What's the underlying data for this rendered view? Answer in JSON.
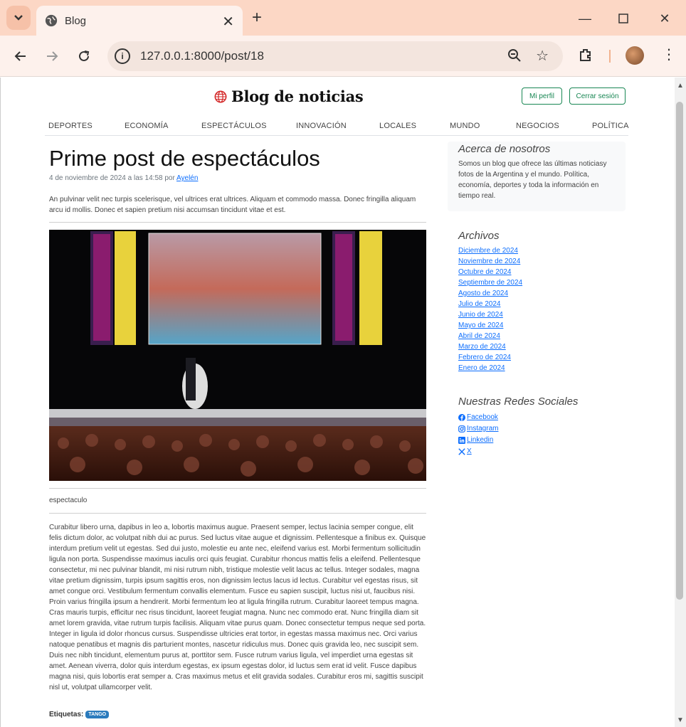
{
  "browser": {
    "tab_title": "Blog",
    "url": "127.0.0.1:8000/post/18"
  },
  "header": {
    "brand": "Blog de noticias",
    "profile_button": "Mi perfil",
    "logout_button": "Cerrar sesión"
  },
  "nav": {
    "items": [
      {
        "label": "DEPORTES"
      },
      {
        "label": "ECONOMÍA"
      },
      {
        "label": "ESPECTÁCULOS"
      },
      {
        "label": "INNOVACIÓN"
      },
      {
        "label": "LOCALES"
      },
      {
        "label": "MUNDO"
      },
      {
        "label": "NEGOCIOS"
      },
      {
        "label": "POLÍTICA"
      }
    ]
  },
  "post": {
    "title": "Prime post de espectáculos",
    "meta": "4 de noviembre de 2024 a las 14:58 por ",
    "author": "Ayelén",
    "lead": "An pulvinar velit nec turpis scelerisque, vel ultrices erat ultrices. Aliquam et commodo massa. Donec fringilla aliquam arcu id mollis. Donec et sapien pretium nisi accumsan tincidunt vitae et est.",
    "caption": "espectaculo",
    "body": "Curabitur libero urna, dapibus in leo a, lobortis maximus augue. Praesent semper, lectus lacinia semper congue, elit felis dictum dolor, ac volutpat nibh dui ac purus. Sed luctus vitae augue et dignissim. Pellentesque a finibus ex. Quisque interdum pretium velit ut egestas. Sed dui justo, molestie eu ante nec, eleifend varius est. Morbi fermentum sollicitudin ligula non porta. Suspendisse maximus iaculis orci quis feugiat. Curabitur rhoncus mattis felis a eleifend. Pellentesque consectetur, mi nec pulvinar blandit, mi nisi rutrum nibh, tristique molestie velit lacus ac tellus. Integer sodales, magna vitae pretium dignissim, turpis ipsum sagittis eros, non dignissim lectus lacus id lectus. Curabitur vel egestas risus, sit amet congue orci. Vestibulum fermentum convallis elementum. Fusce eu sapien suscipit, luctus nisi ut, faucibus nisi. Proin varius fringilla ipsum a hendrerit. Morbi fermentum leo at ligula fringilla rutrum. Curabitur laoreet tempus magna. Cras mauris turpis, efficitur nec risus tincidunt, laoreet feugiat magna. Nunc nec commodo erat. Nunc fringilla diam sit amet lorem gravida, vitae rutrum turpis facilisis. Aliquam vitae purus quam. Donec consectetur tempus neque sed porta. Integer in ligula id dolor rhoncus cursus. Suspendisse ultricies erat tortor, in egestas massa maximus nec. Orci varius natoque penatibus et magnis dis parturient montes, nascetur ridiculus mus. Donec quis gravida leo, nec suscipit sem. Duis nec nibh tincidunt, elementum purus at, porttitor sem. Fusce rutrum varius ligula, vel imperdiet urna egestas sit amet. Aenean viverra, dolor quis interdum egestas, ex ipsum egestas dolor, id luctus sem erat id velit. Fusce dapibus magna nisi, quis lobortis erat semper a. Cras maximus metus et elit gravida sodales. Curabitur eros mi, sagittis suscipit nisl ut, volutpat ullamcorper velit.",
    "tags_label": "Etiquetas:",
    "tag": "TANGO"
  },
  "sidebar": {
    "about_title": "Acerca de nosotros",
    "about_text": "Somos un blog que ofrece las últimas noticiasy fotos de la Argentina y el mundo. Política, economía, deportes y toda la información en tiempo real.",
    "archives_title": "Archivos",
    "archives": [
      {
        "label": "Diciembre de 2024"
      },
      {
        "label": "Noviembre de 2024"
      },
      {
        "label": "Octubre de 2024"
      },
      {
        "label": "Septiembre de 2024"
      },
      {
        "label": "Agosto de 2024"
      },
      {
        "label": "Julio de 2024"
      },
      {
        "label": "Junio de 2024"
      },
      {
        "label": "Mayo de 2024"
      },
      {
        "label": "Abril de 2024"
      },
      {
        "label": "Marzo de 2024"
      },
      {
        "label": "Febrero de 2024"
      },
      {
        "label": "Enero de 2024"
      }
    ],
    "social_title": "Nuestras Redes Sociales",
    "social": [
      {
        "label": " Facebook",
        "icon": "facebook-icon"
      },
      {
        "label": " Instagram",
        "icon": "instagram-icon"
      },
      {
        "label": " Linkedin",
        "icon": "linkedin-icon"
      },
      {
        "label": " X",
        "icon": "x-icon"
      }
    ]
  },
  "colors": {
    "accent_green": "#198754",
    "link_blue": "#0d6efd",
    "chrome_frame": "#fcd7c5"
  }
}
